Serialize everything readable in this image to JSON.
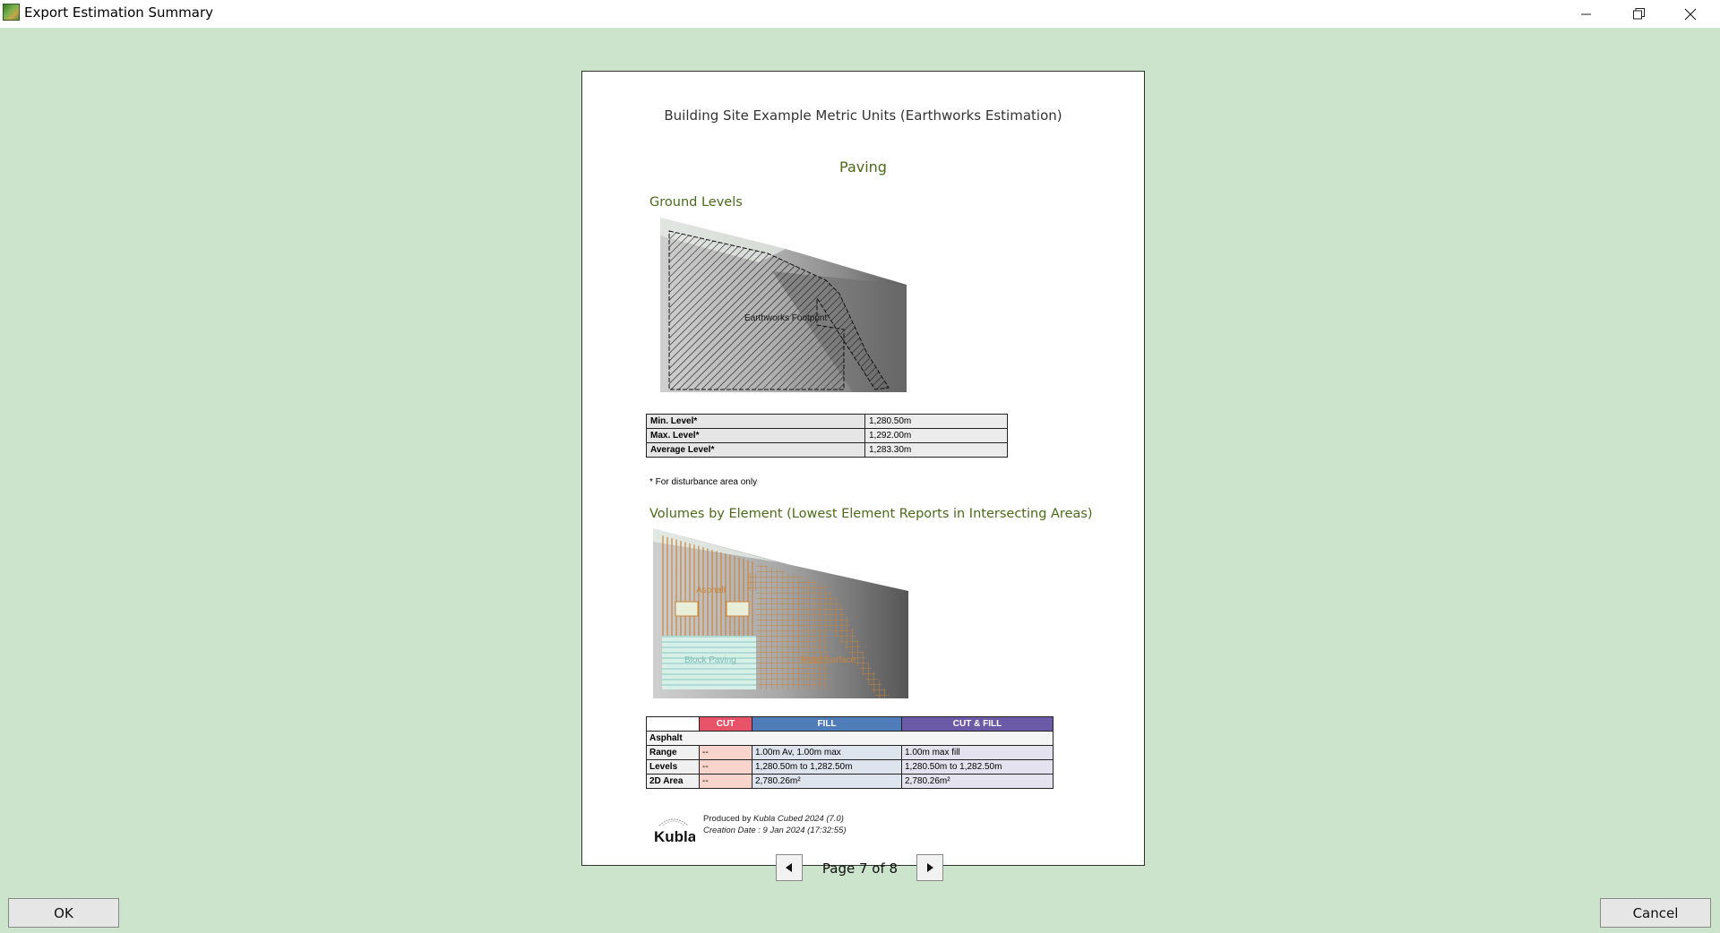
{
  "window": {
    "title": "Export Estimation Summary",
    "icon": "app-icon",
    "controls": [
      "minimize-icon",
      "restore-icon",
      "close-icon"
    ]
  },
  "document": {
    "title": "Building Site Example Metric Units (Earthworks Estimation)",
    "section": "Paving",
    "ground_levels": {
      "heading": "Ground Levels",
      "map_label": "Earthworks Footprint",
      "rows": [
        {
          "label": "Min. Level*",
          "value": "1,280.50m"
        },
        {
          "label": "Max. Level*",
          "value": "1,292.00m"
        },
        {
          "label": "Average Level*",
          "value": "1,283.30m"
        }
      ],
      "note": "* For disturbance area only"
    },
    "volumes": {
      "heading": "Volumes by Element (Lowest Element Reports in Intersecting Areas)",
      "map_labels": {
        "asphalt": "Asphalt",
        "block_paving": "Block Paving",
        "road_surface": "Road Surface"
      },
      "headers": {
        "cut": "CUT",
        "fill": "FILL",
        "cut_fill": "CUT & FILL"
      },
      "colors": {
        "cut": "#e8536a",
        "fill": "#4f7dba",
        "cut_fill": "#6a5aa8"
      },
      "element": "Asphalt",
      "rows": [
        {
          "label": "Range",
          "cut": "--",
          "fill": "1.00m Av, 1.00m max",
          "cut_fill": "1.00m max fill"
        },
        {
          "label": "Levels",
          "cut": "--",
          "fill": "1,280.50m to 1,282.50m",
          "cut_fill": "1,280.50m to 1,282.50m"
        },
        {
          "label": "2D Area",
          "cut": "--",
          "fill": "2,780.26m²",
          "cut_fill": "2,780.26m²"
        }
      ]
    },
    "footer": {
      "logo_text": "Kubla",
      "produced_prefix": "Produced by ",
      "produced_product": "Kubla Cubed 2024 (7.0)",
      "creation_date": "Creation Date : 9 Jan 2024 (17:32:55)"
    }
  },
  "pager": {
    "label": "Page 7 of 8",
    "prev_icon": "triangle-left-icon",
    "next_icon": "triangle-right-icon"
  },
  "buttons": {
    "ok": "OK",
    "cancel": "Cancel"
  }
}
